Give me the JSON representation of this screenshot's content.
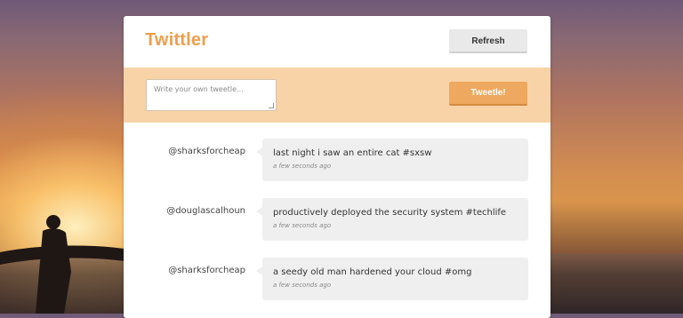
{
  "app": {
    "brand": "Twittler",
    "refresh_label": "Refresh",
    "accent_color": "#ef9f4e"
  },
  "composer": {
    "placeholder": "Write your own tweetle...",
    "submit_label": "Tweetle!"
  },
  "tweets": [
    {
      "user": "@sharksforcheap",
      "message": "last night i saw an entire cat #sxsw",
      "time": "a few seconds ago"
    },
    {
      "user": "@douglascalhoun",
      "message": "productively deployed the security system #techlife",
      "time": "a few seconds ago"
    },
    {
      "user": "@sharksforcheap",
      "message": "a seedy old man hardened your cloud #omg",
      "time": "a few seconds ago"
    }
  ]
}
